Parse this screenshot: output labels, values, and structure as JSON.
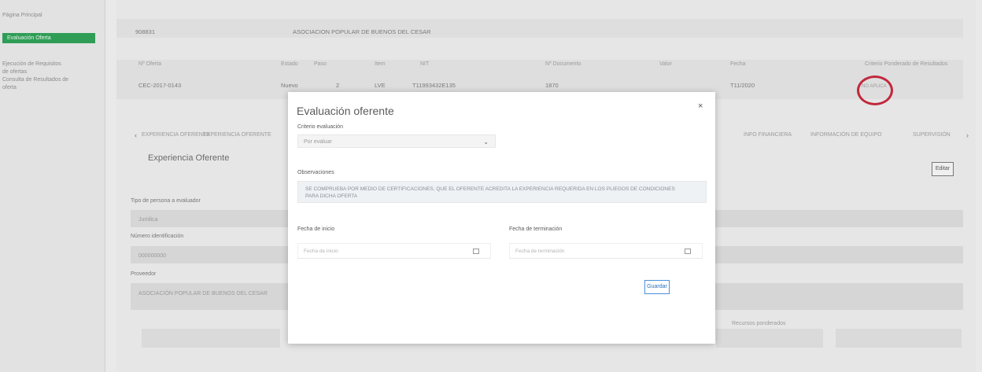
{
  "sidebar": {
    "items": [
      {
        "label": "Página Principal"
      },
      {
        "label": "Evaluación Oferta"
      },
      {
        "label": "Ejecución de Requisitos"
      },
      {
        "label": "de ofertas"
      },
      {
        "label": "Consulta de Resultados de"
      },
      {
        "label": "oferta"
      }
    ]
  },
  "header": {
    "row1": {
      "code": "908831",
      "name": "ASOCIACION POPULAR DE BUENOS DEL CESAR"
    },
    "row2_labels": [
      "Nº Oferta",
      "Estado",
      "Paso",
      "Item",
      "NIT",
      "Nº Documento",
      "Valor",
      "Fecha"
    ],
    "row2_values": [
      "CEC-2017-0143",
      "Nuevo",
      "2",
      "LVE",
      "T11993432E135",
      "1870",
      "",
      "T11/2020"
    ],
    "right_label": "Criterio Ponderado de Resultados",
    "right_value": "NO APLICA"
  },
  "tabs": {
    "items": [
      "EXPERIENCIA OFERENTE",
      "EXPERIENCIA OFERENTE",
      "INFO FINANCIERA",
      "INFORMACIÓN DE EQUIPO",
      "SUPERVISIÓN"
    ]
  },
  "section": {
    "title": "Experiencia Oferente",
    "edit_label": "Editar",
    "field1_label": "Tipo de persona a evaluador",
    "field1_value": "Jurídica",
    "field2_label": "Número identificación",
    "field2_value": "000000000",
    "field3_label": "Proveedor",
    "field3_value": "ASOCIACIÓN POPULAR DE BUENOS DEL CESAR",
    "footer_label": "Recursos ponderados"
  },
  "modal": {
    "title": "Evaluación oferente",
    "close_icon": "×",
    "criteria_label": "Criterio evaluación",
    "criteria_value": "Por evaluar",
    "obs_label": "Observaciones",
    "obs_text": "SE COMPRUEBA POR MEDIO DE CERTIFICACIONES, QUE EL OFERENTE ACREDITA LA EXPERIENCIA REQUERIDA EN LOS PLIEGOS DE CONDICIONES",
    "obs_text2": "PARA DICHA OFERTA",
    "start_label": "Fecha de inicio",
    "start_placeholder": "Fecha de inicio",
    "end_label": "Fecha de terminación",
    "end_placeholder": "Fecha de terminación",
    "save_label": "Guardar"
  }
}
